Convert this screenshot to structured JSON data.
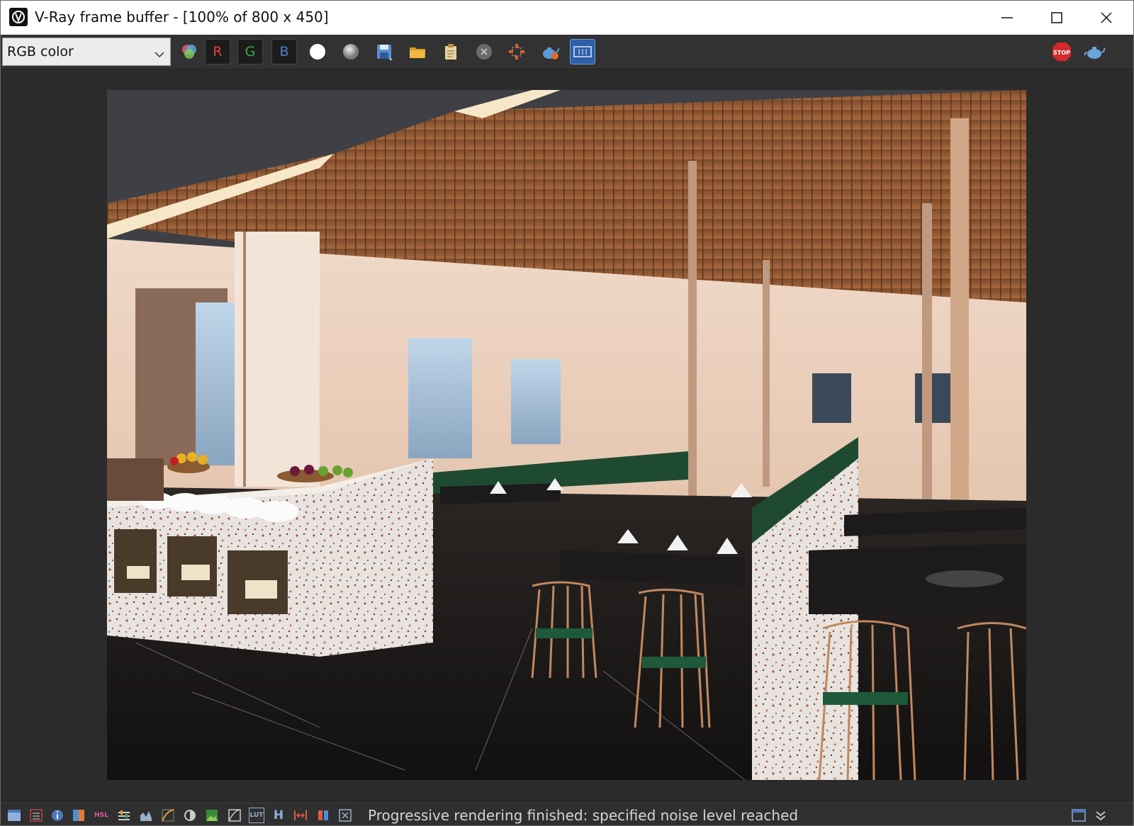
{
  "window": {
    "title": "V-Ray frame buffer - [100% of 800 x 450]",
    "controls": {
      "minimize": "minimize",
      "maximize": "maximize",
      "close": "close"
    }
  },
  "toolbar": {
    "channel": "RGB color",
    "buttons": [
      {
        "name": "color-channels-icon",
        "type": "icon"
      },
      {
        "name": "red-channel-button",
        "label": "R",
        "color": "#e0453a"
      },
      {
        "name": "green-channel-button",
        "label": "G",
        "color": "#3aa64a"
      },
      {
        "name": "blue-channel-button",
        "label": "B",
        "color": "#4a7fd8"
      },
      {
        "name": "white-circle-icon",
        "type": "icon"
      },
      {
        "name": "grey-sphere-icon",
        "type": "icon"
      },
      {
        "name": "save-icon",
        "type": "icon"
      },
      {
        "name": "open-folder-icon",
        "type": "icon"
      },
      {
        "name": "clipboard-icon",
        "type": "icon"
      },
      {
        "name": "clear-icon",
        "type": "icon"
      },
      {
        "name": "region-render-icon",
        "type": "icon"
      },
      {
        "name": "teapot-render-icon",
        "type": "icon"
      },
      {
        "name": "film-strip-icon",
        "type": "icon"
      },
      {
        "name": "stop-render-icon",
        "type": "icon"
      },
      {
        "name": "teapot-icon",
        "type": "icon"
      }
    ]
  },
  "render": {
    "description_alt": ""
  },
  "statusbar": {
    "message": "Progressive rendering finished: specified noise level reached",
    "icon_labels": {
      "hsl": "HSL",
      "lut": "LUT",
      "h": "H"
    }
  },
  "colors": {
    "accent_red": "#e0453a",
    "accent_green": "#3aa64a",
    "accent_blue": "#4a7fd8"
  }
}
